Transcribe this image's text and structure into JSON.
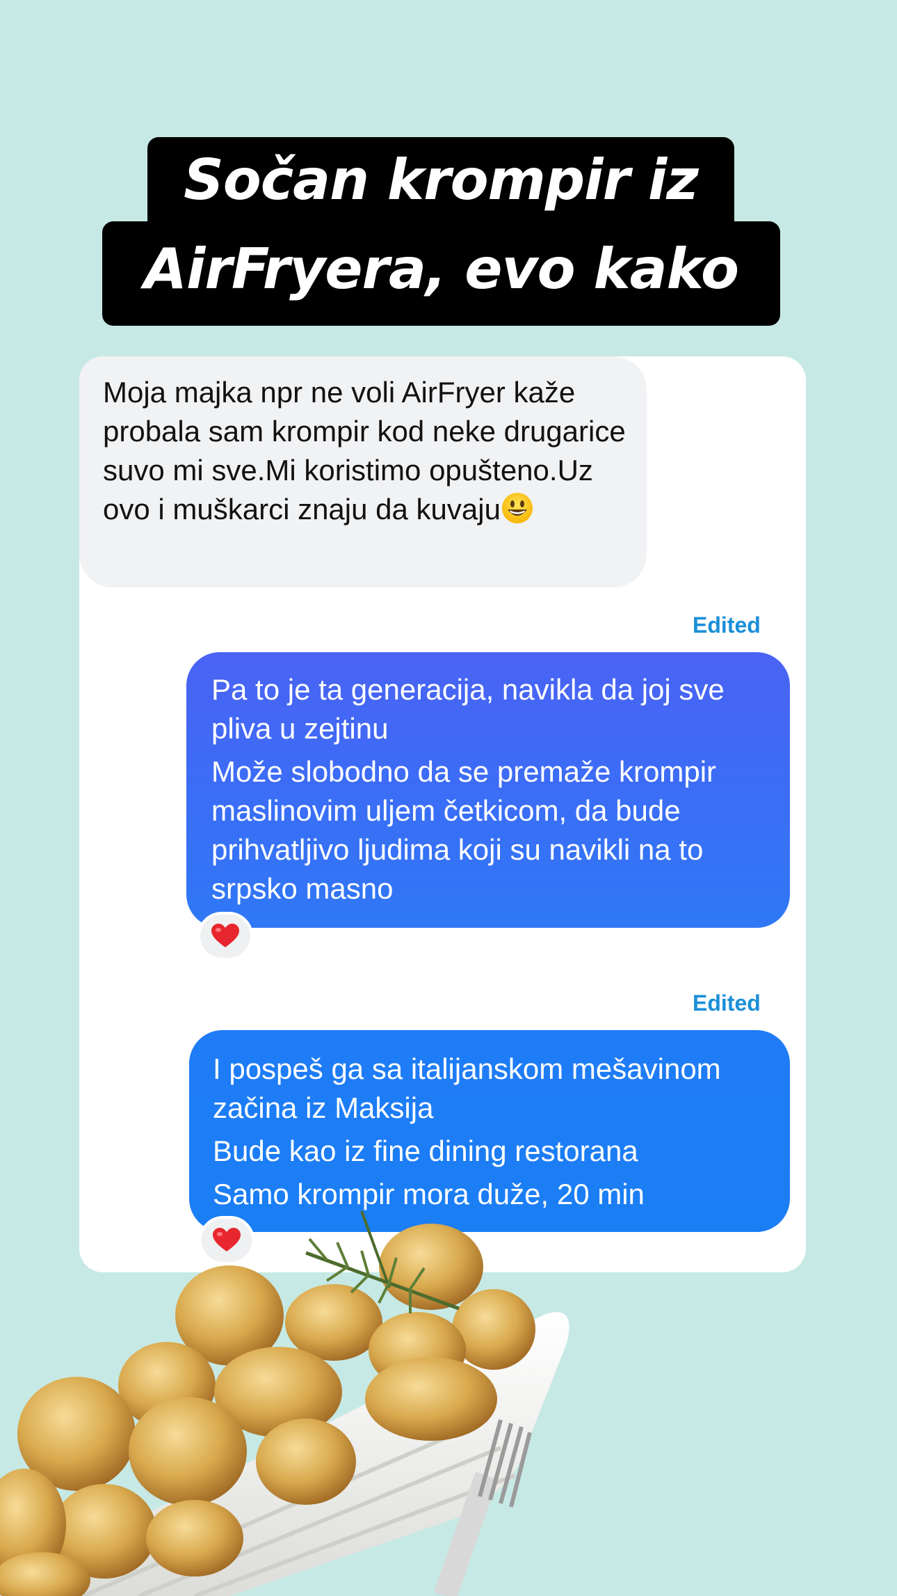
{
  "title": {
    "line1": "Sočan krompir iz",
    "line2": "AirFryera, evo kako"
  },
  "chat": {
    "messages": [
      {
        "direction": "incoming",
        "text": "Moja majka npr ne voli AirFryer kaže probala sam krompir kod neke drugarice suvo mi sve.Mi koristimo opušteno.Uz ovo i muškarci znaju da kuvaju",
        "emoji": "grinning-face-icon"
      },
      {
        "direction": "outgoing",
        "status": "Edited",
        "paragraphs": [
          "Pa to je ta generacija, navikla da joj sve pliva u zejtinu",
          "Može slobodno da se premaže krompir maslinovim uljem četkicom, da bude prihvatljivo ljudima koji su navikli na to srpsko masno"
        ],
        "reaction": "heart-icon"
      },
      {
        "direction": "outgoing",
        "status": "Edited",
        "paragraphs": [
          "I pospeš ga sa italijanskom mešavinom začina iz Maksija",
          "Bude kao iz fine dining restorana",
          "Samo krompir mora duže, 20 min"
        ],
        "reaction": "heart-icon"
      }
    ]
  },
  "colors": {
    "background": "#c6e9e5",
    "incoming_bubble": "#f1f2f4",
    "outgoing_bubble_1": "#3a6ef6",
    "outgoing_bubble_2": "#1f7cf6",
    "edited_label": "#1a8fd8",
    "heart": "#e8262f"
  }
}
